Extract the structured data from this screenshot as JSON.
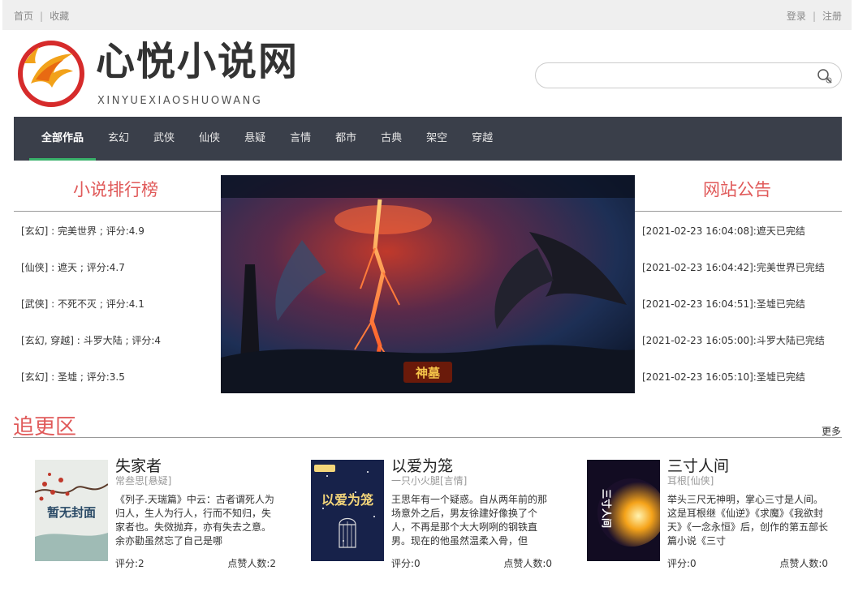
{
  "topbar": {
    "home": "首页",
    "favorite": "收藏",
    "login": "登录",
    "register": "注册",
    "separator": "|"
  },
  "site": {
    "title": "心悦小说网",
    "subtitle": "XINYUEXIAOSHUOWANG"
  },
  "search": {
    "placeholder": "",
    "value": ""
  },
  "nav": {
    "items": [
      "全部作品",
      "玄幻",
      "武侠",
      "仙侠",
      "悬疑",
      "言情",
      "都市",
      "古典",
      "架空",
      "穿越"
    ],
    "active": 0
  },
  "ranking": {
    "title": "小说排行榜",
    "items": [
      "[玄幻] : 完美世界 ; 评分:4.9",
      "[仙侠] : 遮天 ; 评分:4.7",
      "[武侠] : 不死不灭 ; 评分:4.1",
      "[玄幻, 穿越] : 斗罗大陆 ; 评分:4",
      "[玄幻] : 圣墟 ; 评分:3.5"
    ]
  },
  "notice": {
    "title": "网站公告",
    "items": [
      "[2021-02-23 16:04:08]:遮天已完结",
      "[2021-02-23 16:04:42]:完美世界已完结",
      "[2021-02-23 16:04:51]:圣墟已完结",
      "[2021-02-23 16:05:00]:斗罗大陆已完结",
      "[2021-02-23 16:05:10]:圣墟已完结"
    ]
  },
  "banner": {
    "logo_text": "神墓"
  },
  "follow": {
    "title": "追更区",
    "more": "更多",
    "books": [
      {
        "title": "失家者",
        "author": "常叁思[悬疑]",
        "desc": "《列子.天瑞篇》中云：古者谓死人为归人，生人为行人，行而不知归，失家者也。失傚抛弃，亦有失去之意。余亦勸虽然忘了自己是哪",
        "score": "评分:2",
        "likes": "点赞人数:2",
        "cover_text": "暂无封面"
      },
      {
        "title": "以爱为笼",
        "author": "一只小火腿[言情]",
        "desc": "王思年有一个疑惑。自从两年前的那场意外之后，男友徐建好像换了个人，不再是那个大大咧咧的钢铁直男。现在的他虽然温柔入骨，但",
        "score": "评分:0",
        "likes": "点赞人数:0",
        "cover_text": "以爱为笼"
      },
      {
        "title": "三寸人间",
        "author": "耳根[仙侠]",
        "desc": "举头三尺无神明，掌心三寸是人间。　　这是耳根继《仙逆》《求魔》《我欲封天》《一念永恒》后，创作的第五部长篇小说《三寸",
        "score": "评分:0",
        "likes": "点赞人数:0",
        "cover_text": "三寸人间"
      }
    ]
  },
  "colors": {
    "accent_red": "#e05a5a",
    "nav_bg": "#3a3f4a",
    "nav_active_underline": "#39b16a",
    "topbar_bg": "#efefef"
  }
}
